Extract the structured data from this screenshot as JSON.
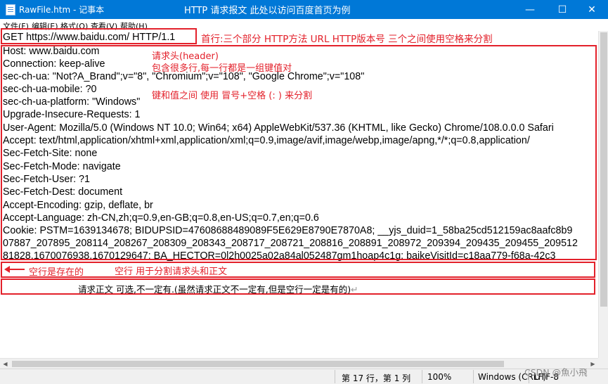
{
  "window": {
    "title": "RawFile.htm - 记事本",
    "title_annotation": "HTTP 请求报文    此处以访问百度首页为例",
    "min_glyph": "—",
    "max_glyph": "☐",
    "close_glyph": "✕"
  },
  "menu": [
    "文件(F)",
    "编辑(E)",
    "格式(O)",
    "查看(V)",
    "帮助(H)"
  ],
  "lines": [
    "GET https://www.baidu.com/ HTTP/1.1",
    "Host: www.baidu.com",
    "Connection: keep-alive",
    "sec-ch-ua: \"Not?A_Brand\";v=\"8\", \"Chromium\";v=\"108\", \"Google Chrome\";v=\"108\"",
    "sec-ch-ua-mobile: ?0",
    "sec-ch-ua-platform: \"Windows\"",
    "Upgrade-Insecure-Requests: 1",
    "User-Agent: Mozilla/5.0 (Windows NT 10.0; Win64; x64) AppleWebKit/537.36 (KHTML, like Gecko) Chrome/108.0.0.0 Safari",
    "Accept: text/html,application/xhtml+xml,application/xml;q=0.9,image/avif,image/webp,image/apng,*/*;q=0.8,application/",
    "Sec-Fetch-Site: none",
    "Sec-Fetch-Mode: navigate",
    "Sec-Fetch-User: ?1",
    "Sec-Fetch-Dest: document",
    "Accept-Encoding: gzip, deflate, br",
    "Accept-Language: zh-CN,zh;q=0.9,en-GB;q=0.8,en-US;q=0.7,en;q=0.6",
    "Cookie: PSTM=1639134678; BIDUPSID=47608688489089F5E629E8790E7870A8; __yjs_duid=1_58ba25cd512159ac8aafc8b9",
    "07887_207895_208114_208267_208309_208343_208717_208721_208816_208891_208972_209394_209435_209455_209512",
    "81828,1670076938,1670129647; BA_HECTOR=0l2h0025a02a84al052487gm1hoap4c1g; baikeVisitId=c18aa779-f68a-42c3"
  ],
  "annotations": {
    "first_line": "首行:三个部分 HTTP方法 URL HTTP版本号 三个之间使用空格来分割",
    "header_title": "请求头(header)",
    "header_desc": "包含很多行,每一行都是一组键值对",
    "header_sep": "键和值之间 使用 冒号+空格 (: ) 来分割",
    "blank_exists": "空行是存在的",
    "blank_purpose": "空行  用于分割请求头和正文",
    "body": "请求正文  可选,不一定有.(虽然请求正文不一定有,但是空行一定是有的)",
    "return_mark": "↵"
  },
  "statusbar": {
    "position": "第 17 行，第 1 列",
    "zoom": "100%",
    "line_ending": "Windows (CRLF)",
    "encoding": "UTF-8"
  },
  "watermark": "CSDN @魚小飛",
  "colors": {
    "titlebar": "#0078d7",
    "annotation": "#e3212b"
  }
}
